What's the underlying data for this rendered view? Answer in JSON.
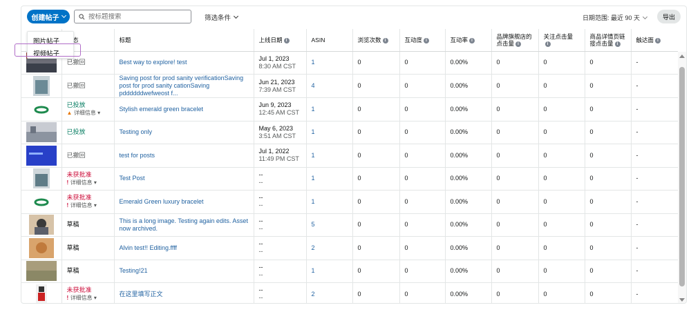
{
  "toolbar": {
    "create_label": "创建帖子",
    "search_placeholder": "按标题搜索",
    "filter_label": "筛选条件",
    "date_range_label": "日期范围: 最近 90 天",
    "export_label": "导出"
  },
  "create_menu": {
    "items": [
      "图片帖子",
      "视频帖子"
    ]
  },
  "table": {
    "headers": {
      "status": "状态",
      "title": "标题",
      "date": "上线日期",
      "asin": "ASIN",
      "views": "浏览次数",
      "engagement": "互动度",
      "engagement_rate": "互动率",
      "store_clicks_1": "品牌旗舰店的",
      "store_clicks_2": "点击量",
      "follow_clicks": "关注点击量",
      "detail_clicks_1": "商品详情页链",
      "detail_clicks_2": "接点击量",
      "reach": "触达面"
    },
    "rows": [
      {
        "status": "已撤回",
        "status_type": "grey",
        "detail": "",
        "title": "Best way to explore! test",
        "date": "Jul 1, 2023",
        "time": "8:30 AM CST",
        "asin": "1",
        "views": "0",
        "engagement": "0",
        "rate": "0.00%",
        "store": "0",
        "follow": "0",
        "detail_clicks": "0",
        "reach": "-"
      },
      {
        "status": "已撤回",
        "status_type": "grey",
        "detail": "",
        "title": "Saving post for prod sanity verificationSaving post for prod sanity cationSaving pddddddwefweost f...",
        "date": "Jun 21, 2023",
        "time": "7:39 AM CST",
        "asin": "4",
        "views": "0",
        "engagement": "0",
        "rate": "0.00%",
        "store": "0",
        "follow": "0",
        "detail_clicks": "0",
        "reach": "-"
      },
      {
        "status": "已投放",
        "status_type": "green",
        "detail": "详细信息",
        "detail_type": "warn",
        "title": "Stylish emerald green bracelet",
        "date": "Jun 9, 2023",
        "time": "12:45 AM CST",
        "asin": "1",
        "views": "0",
        "engagement": "0",
        "rate": "0.00%",
        "store": "0",
        "follow": "0",
        "detail_clicks": "0",
        "reach": "-"
      },
      {
        "status": "已投放",
        "status_type": "green",
        "detail": "",
        "title": "Testing only",
        "date": "May 6, 2023",
        "time": "3:51 AM CST",
        "asin": "1",
        "views": "0",
        "engagement": "0",
        "rate": "0.00%",
        "store": "0",
        "follow": "0",
        "detail_clicks": "0",
        "reach": "-"
      },
      {
        "status": "已撤回",
        "status_type": "grey",
        "detail": "",
        "title": "test for posts",
        "date": "Jul 1, 2022",
        "time": "11:49 PM CST",
        "asin": "1",
        "views": "0",
        "engagement": "0",
        "rate": "0.00%",
        "store": "0",
        "follow": "0",
        "detail_clicks": "0",
        "reach": "-"
      },
      {
        "status": "未获批准",
        "status_type": "red",
        "detail": "详细信息",
        "detail_type": "error",
        "title": "Test Post",
        "date": "--",
        "time": "--",
        "asin": "1",
        "views": "0",
        "engagement": "0",
        "rate": "0.00%",
        "store": "0",
        "follow": "0",
        "detail_clicks": "0",
        "reach": "-"
      },
      {
        "status": "未获批准",
        "status_type": "red",
        "detail": "详细信息",
        "detail_type": "error",
        "title": "Emerald Green luxury bracelet",
        "date": "--",
        "time": "--",
        "asin": "1",
        "views": "0",
        "engagement": "0",
        "rate": "0.00%",
        "store": "0",
        "follow": "0",
        "detail_clicks": "0",
        "reach": "-"
      },
      {
        "status": "草稿",
        "status_type": "dark",
        "detail": "",
        "title": "This is a long image. Testing again edits. Asset now archived.",
        "date": "--",
        "time": "--",
        "asin": "5",
        "views": "0",
        "engagement": "0",
        "rate": "0.00%",
        "store": "0",
        "follow": "0",
        "detail_clicks": "0",
        "reach": "-"
      },
      {
        "status": "草稿",
        "status_type": "dark",
        "detail": "",
        "title": "Alvin test!! Editing.ffff",
        "date": "--",
        "time": "--",
        "asin": "2",
        "views": "0",
        "engagement": "0",
        "rate": "0.00%",
        "store": "0",
        "follow": "0",
        "detail_clicks": "0",
        "reach": "-"
      },
      {
        "status": "草稿",
        "status_type": "dark",
        "detail": "",
        "title": "Testing!21",
        "date": "--",
        "time": "--",
        "asin": "1",
        "views": "0",
        "engagement": "0",
        "rate": "0.00%",
        "store": "0",
        "follow": "0",
        "detail_clicks": "0",
        "reach": "-"
      },
      {
        "status": "未获批准",
        "status_type": "red",
        "detail": "详细信息",
        "detail_type": "error",
        "title": "在这里填写正文",
        "date": "--",
        "time": "--",
        "asin": "2",
        "views": "0",
        "engagement": "0",
        "rate": "0.00%",
        "store": "0",
        "follow": "0",
        "detail_clicks": "0",
        "reach": "-"
      }
    ]
  },
  "colors": {
    "primary": "#0073c7",
    "link": "#2162a1",
    "green": "#067d62",
    "red": "#cc0c39",
    "highlight": "#b06cc7"
  }
}
